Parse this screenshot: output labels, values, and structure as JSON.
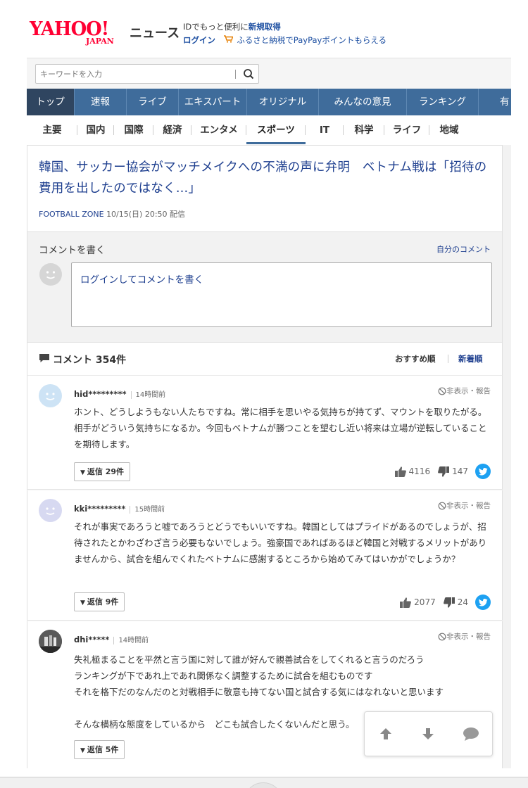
{
  "header": {
    "logo_text": "YAHOO!",
    "logo_sub": "JAPAN",
    "service": "ニュース",
    "promo_prefix": "IDでもっと便利に",
    "promo_link": "新規取得",
    "login": "ログイン",
    "furusato": "ふるさと納税でPayPayポイントもらえる"
  },
  "search": {
    "placeholder": "キーワードを入力"
  },
  "nav": {
    "items": [
      "トップ",
      "速報",
      "ライブ",
      "エキスパート",
      "オリジナル",
      "みんなの意見",
      "ランキング",
      "有"
    ],
    "active": "トップ"
  },
  "categories": {
    "items": [
      "主要",
      "国内",
      "国際",
      "経済",
      "エンタメ",
      "スポーツ",
      "IT",
      "科学",
      "ライフ",
      "地域"
    ],
    "active": "スポーツ"
  },
  "article": {
    "title": "韓国、サッカー協会がマッチメイクへの不満の声に弁明　ベトナム戦は「招待の費用を出したのではなく…」",
    "source": "FOOTBALL ZONE",
    "date": "10/15(日) 20:50 配信"
  },
  "comment_form": {
    "title": "コメントを書く",
    "my_comments": "自分のコメント",
    "prompt": "ログインしてコメントを書く"
  },
  "comments_header": {
    "count_label": "コメント 354件",
    "sort_recommended": "おすすめ順",
    "sort_newest": "新着順"
  },
  "comments": [
    {
      "user": "hid*********",
      "time": "14時間前",
      "hide_report": "非表示・報告",
      "body": "ホント、どうしようもない人たちですね。常に相手を思いやる気持ちが持てず、マウントを取りたがる。相手がどういう気持ちになるか。今回もベトナムが勝つことを望むし近い将来は立場が逆転していることを期待します。",
      "reply": "返信 29件",
      "likes": "4116",
      "dislikes": "147"
    },
    {
      "user": "kki*********",
      "time": "15時間前",
      "hide_report": "非表示・報告",
      "body": "それが事実であろうと嘘であろうとどうでもいいですね。韓国としてはプライドがあるのでしょうが、招待されたとかわざわざ言う必要もないでしょう。強豪国であればあるほど韓国と対戦するメリットがありませんから、試合を組んでくれたベトナムに感謝するところから始めてみてはいかがでしょうか？",
      "reply": "返信 9件",
      "likes": "2077",
      "dislikes": "24"
    },
    {
      "user": "dhi*****",
      "time": "14時間前",
      "hide_report": "非表示・報告",
      "body": "失礼極まることを平然と言う国に対して誰が好んで親善試合をしてくれると言うのだろう\nランキングが下であれ上であれ関係なく調整するために試合を組むものです\nそれを格下だのなんだのと対戦相手に敬意も持てない国と試合する気にはなれないと思います\n\nそんな横柄な態度をしているから　どこも試合したくないんだと思う。",
      "reply": "返信 5件"
    }
  ],
  "colors": {
    "nav_bg": "#3f6c9b",
    "nav_active": "#2f4560",
    "link_blue": "#1e3f8f",
    "logo_red": "#ff0033",
    "twitter": "#1da1f2"
  }
}
